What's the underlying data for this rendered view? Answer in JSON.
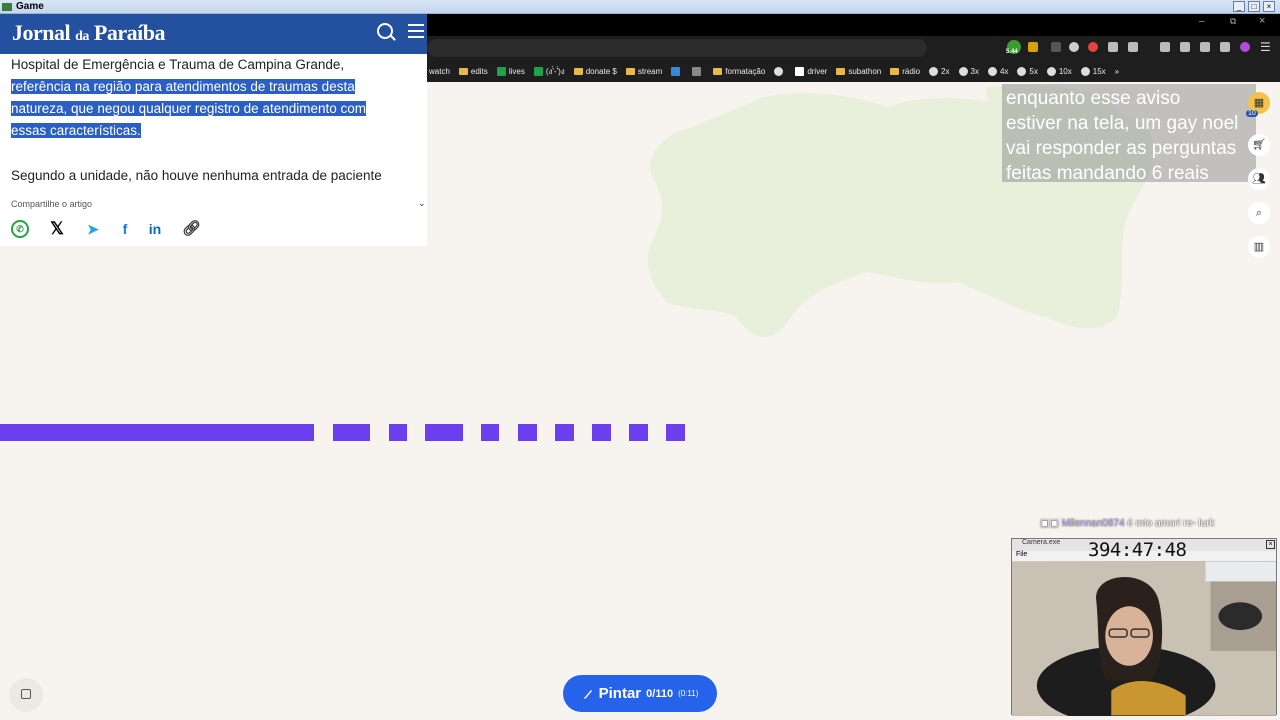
{
  "window": {
    "title": "Game"
  },
  "news": {
    "logo_main": "Jornal",
    "logo_small": "da",
    "logo_end": "Paraíba",
    "para1_line1": "Hospital de Emergência e Trauma de Campina Grande,",
    "para1_line2": "referência na região para atendimentos de traumas desta",
    "para1_line3": "natureza, que negou qualquer registro de atendimento com",
    "para1_line4": "essas características.",
    "para2": "Segundo a unidade, não houve nenhuma entrada de paciente",
    "share_label": "Compartilhe o artigo"
  },
  "bookmarks": [
    {
      "label": "watch",
      "icon": "none"
    },
    {
      "label": "edits",
      "icon": "folder"
    },
    {
      "label": "lives",
      "icon": "green-plus"
    },
    {
      "label": "(ง'̀-'́)ง",
      "icon": "green"
    },
    {
      "label": "donate $",
      "icon": "folder"
    },
    {
      "label": "stream",
      "icon": "folder"
    },
    {
      "label": "",
      "icon": "blue-square"
    },
    {
      "label": "",
      "icon": "grid"
    },
    {
      "label": "formatação",
      "icon": "folder"
    },
    {
      "label": "",
      "icon": "globe"
    },
    {
      "label": "driver",
      "icon": "white-square"
    },
    {
      "label": "subathon",
      "icon": "folder"
    },
    {
      "label": "rádio",
      "icon": "folder"
    },
    {
      "label": "2x",
      "icon": "globe"
    },
    {
      "label": "3x",
      "icon": "globe"
    },
    {
      "label": "4x",
      "icon": "globe"
    },
    {
      "label": "5x",
      "icon": "globe"
    },
    {
      "label": "10x",
      "icon": "globe"
    },
    {
      "label": "15x",
      "icon": "globe"
    },
    {
      "label": "»",
      "icon": "none"
    }
  ],
  "toolbar": {
    "badge": "5.44"
  },
  "overlay": {
    "line1": "enquanto esse aviso",
    "line2": "estiver na tela, um gay noel",
    "line3": "vai responder as perguntas",
    "line4": "feitas mandando 6 reais"
  },
  "side_tools": {
    "badge": "10"
  },
  "chat": {
    "username": "Milennan0874",
    "message": "é mto amor! re- lurk"
  },
  "cam": {
    "title": "Camera.exe",
    "menu": "File",
    "clock": "394:47:48"
  },
  "paint": {
    "label": "Pintar",
    "count": "0/110",
    "timer": "(0:11)"
  },
  "colors": {
    "accent_purple": "#6b3ff0",
    "button_blue": "#2563eb",
    "news_blue": "#2450a0"
  }
}
